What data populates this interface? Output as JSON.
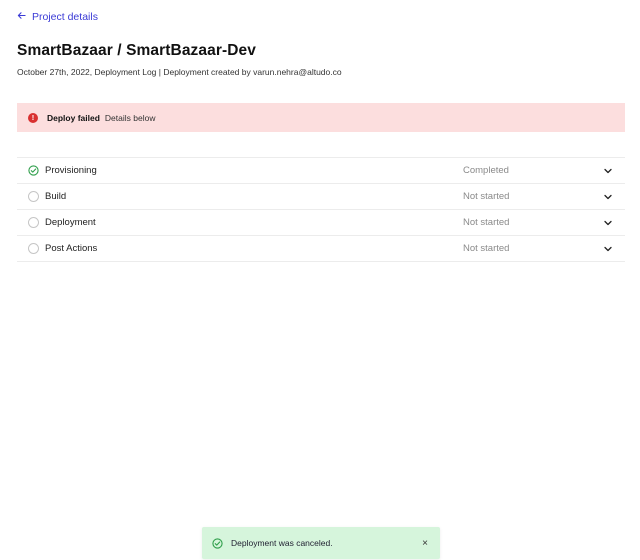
{
  "nav": {
    "back_label": "Project details"
  },
  "header": {
    "title": "SmartBazaar / SmartBazaar-Dev",
    "subtitle": "October 27th, 2022, Deployment Log | Deployment created by varun.nehra@altudo.co"
  },
  "alert": {
    "title": "Deploy failed",
    "detail": "Details below",
    "icon": "error-icon",
    "color": "#d93030",
    "background": "#fcdede"
  },
  "steps": [
    {
      "name": "Provisioning",
      "status": "Completed",
      "icon": "check-circle-icon"
    },
    {
      "name": "Build",
      "status": "Not started",
      "icon": "empty-circle-icon"
    },
    {
      "name": "Deployment",
      "status": "Not started",
      "icon": "empty-circle-icon"
    },
    {
      "name": "Post Actions",
      "status": "Not started",
      "icon": "empty-circle-icon"
    }
  ],
  "toast": {
    "message": "Deployment was canceled.",
    "close_glyph": "×",
    "icon": "check-circle-icon",
    "background": "#d6f5dc"
  },
  "colors": {
    "link": "#3b3bd6",
    "success": "#2e9e4a"
  }
}
